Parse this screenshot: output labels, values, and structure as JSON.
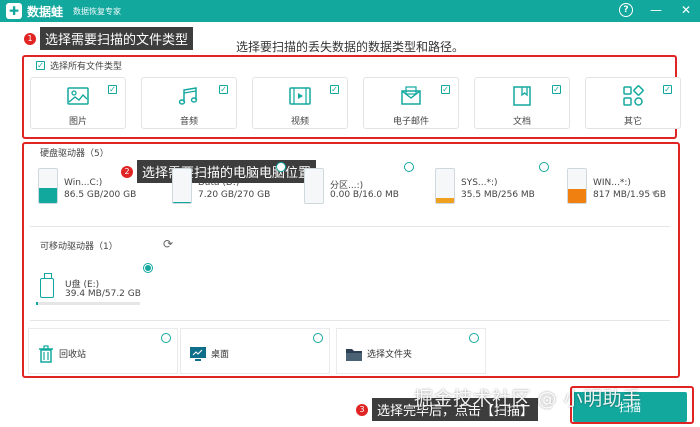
{
  "header": {
    "app_name": "数据蛙",
    "subtitle": "数据恢复专家",
    "icons": [
      "help-icon",
      "minimize-icon",
      "close-icon"
    ]
  },
  "annotations": {
    "step1": {
      "num": "1",
      "text": "选择需要扫描的文件类型"
    },
    "step2": {
      "num": "2",
      "text": "选择需要扫描的电脑电脑位置"
    },
    "step3": {
      "num": "3",
      "text": "选择完毕后，点击【扫描】"
    }
  },
  "prompt": "选择要扫描的丢失数据的数据类型和路径。",
  "file_types": {
    "select_all_label": "选择所有文件类型",
    "items": [
      {
        "label": "图片",
        "icon": "image-icon",
        "checked": true
      },
      {
        "label": "音频",
        "icon": "music-icon",
        "checked": true
      },
      {
        "label": "视频",
        "icon": "video-icon",
        "checked": true
      },
      {
        "label": "电子邮件",
        "icon": "email-icon",
        "checked": true
      },
      {
        "label": "文档",
        "icon": "document-icon",
        "checked": true
      },
      {
        "label": "其它",
        "icon": "other-icon",
        "checked": true
      }
    ]
  },
  "drives": {
    "title": "硬盘驱动器（5）",
    "items": [
      {
        "name": "Win...C:)",
        "size": "86.5 GB/200 GB",
        "used_fraction": 0.43,
        "color": "#13a89e"
      },
      {
        "name": "Data (D:)",
        "size": "7.20 GB/270 GB",
        "used_fraction": 0.03,
        "color": "#13a89e"
      },
      {
        "name": "分区...:)",
        "size": "0.00  B/16.0 MB",
        "used_fraction": 0.0,
        "color": "#13a89e"
      },
      {
        "name": "SYS...*:)",
        "size": "35.5 MB/256 MB",
        "used_fraction": 0.14,
        "color": "#f0a020"
      },
      {
        "name": "WIN...*:)",
        "size": "817 MB/1.95 GB",
        "used_fraction": 0.42,
        "color": "#f08010"
      }
    ]
  },
  "removable": {
    "title": "可移动驱动器（1）",
    "items": [
      {
        "name": "U盘 (E:)",
        "size": "39.4 MB/57.2 GB",
        "used_fraction": 0.0007,
        "selected": true
      }
    ]
  },
  "locations": [
    {
      "label": "回收站",
      "icon": "recycle-bin-icon"
    },
    {
      "label": "桌面",
      "icon": "desktop-icon"
    },
    {
      "label": "选择文件夹",
      "icon": "folder-icon"
    }
  ],
  "scan_button": "扫描",
  "watermark": "掘金技术社区 @ 小明助手",
  "colors": {
    "accent": "#13a89e",
    "annotation": "#e02424"
  }
}
